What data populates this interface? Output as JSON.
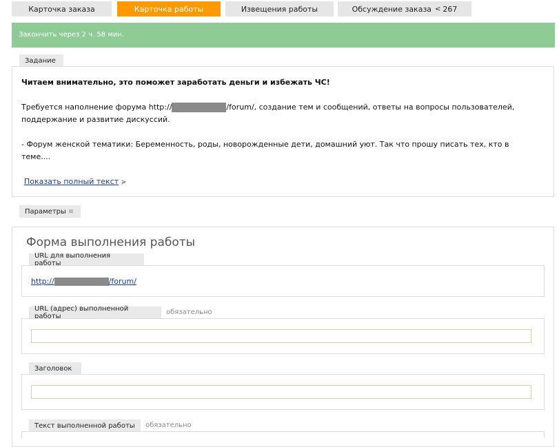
{
  "tabs": [
    {
      "label": "Карточка заказа"
    },
    {
      "label": "Карточка работы"
    },
    {
      "label": "Извещения работы"
    },
    {
      "label": "Обсуждение заказа",
      "arrow": "<",
      "count": "267"
    }
  ],
  "banner": {
    "text": "Закончить через 2 ч. 58 мин."
  },
  "task": {
    "label": "Задание",
    "headline": "Читаем внимательно, это поможет заработать деньги и избежать ЧС!",
    "para1_start": "Требуется наполнение форума http://",
    "para1_end": "/forum/, создание тем и сообщений, ответы на вопросы пользователей,",
    "para1_line2": "поддержание и развитие дискуссий.",
    "para2_line1": "- Форум женской тематики: Беременность, роды, новорожденные дети, домашний уют. Так что прошу писать тех, кто в",
    "para2_line2": "теме....",
    "show_full": "Показать полный текст",
    "show_full_icon": "≽"
  },
  "params": {
    "label": "Параметры",
    "icon": "≡"
  },
  "form": {
    "title": "Форма выполнения работы",
    "url_section": {
      "label": "URL для выполнения работы",
      "link_start": "http://",
      "link_end": "/forum/"
    },
    "result_url": {
      "label": "URL (адрес) выполненной работы",
      "required": "обязательно",
      "value": ""
    },
    "heading": {
      "label": "Заголовок",
      "value": ""
    },
    "text": {
      "label": "Текст выполненной работы",
      "required": "обязательно"
    }
  },
  "colors": {
    "active_tab": "#ff9900",
    "banner": "#8fcb95",
    "link": "#1a3d8f"
  }
}
